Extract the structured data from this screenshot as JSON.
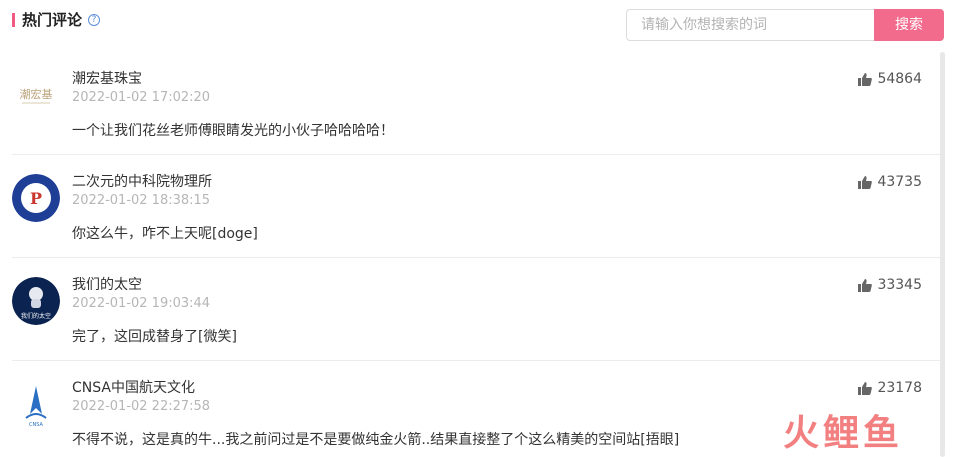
{
  "header": {
    "title": "热门评论",
    "help_icon": "?"
  },
  "search": {
    "placeholder": "请输入你想搜索的词",
    "button_label": "搜索"
  },
  "comments": [
    {
      "name": "潮宏基珠宝",
      "time": "2022-01-02 17:02:20",
      "text": "一个让我们花丝老师傅眼睛发光的小伙子哈哈哈哈！",
      "likes": "54864",
      "avatar": "潮宏基"
    },
    {
      "name": "二次元的中科院物理所",
      "time": "2022-01-02 18:38:15",
      "text": "你这么牛，咋不上天呢[doge]",
      "likes": "43735",
      "avatar": "P"
    },
    {
      "name": "我们的太空",
      "time": "2022-01-02 19:03:44",
      "text": "完了，这回成替身了[微笑]",
      "likes": "33345",
      "avatar": "我们的太空"
    },
    {
      "name": "CNSA中国航天文化",
      "time": "2022-01-02 22:27:58",
      "text": "不得不说，这是真的牛...我之前问过是不是要做纯金火箭..结果直接整了个这么精美的空间站[捂眼]",
      "likes": "23178",
      "avatar": "CNSA"
    }
  ],
  "watermark": "火鲤鱼",
  "colors": {
    "accent": "#f26b8d",
    "title_bar": "#f05a82"
  }
}
